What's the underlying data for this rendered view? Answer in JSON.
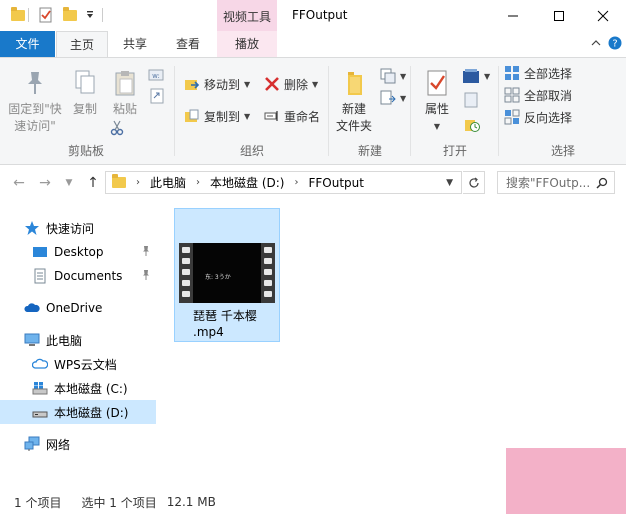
{
  "titlebar": {
    "contextual_tab_group": "视频工具",
    "window_title": "FFOutput",
    "buttons": [
      "minimize-icon",
      "maximize-icon",
      "close-icon"
    ]
  },
  "ribbon_tabs": {
    "file": "文件",
    "home": "主页",
    "share": "共享",
    "view": "查看",
    "play": "播放"
  },
  "ribbon": {
    "clipboard": {
      "title": "剪贴板",
      "pin_quick_access": "固定到\"快速访问\"",
      "pin_line1": "固定到\"快",
      "pin_line2": "速访问\"",
      "copy": "复制",
      "paste": "粘贴"
    },
    "organize": {
      "title": "组织",
      "move_to": "移动到",
      "copy_to": "复制到",
      "delete": "删除",
      "rename": "重命名"
    },
    "new": {
      "title": "新建",
      "new_folder_line1": "新建",
      "new_folder_line2": "文件夹"
    },
    "open": {
      "title": "打开",
      "properties": "属性"
    },
    "select": {
      "title": "选择",
      "select_all": "全部选择",
      "select_none": "全部取消",
      "invert": "反向选择"
    }
  },
  "address": {
    "crumbs": [
      "此电脑",
      "本地磁盘 (D:)",
      "FFOutput"
    ],
    "search_placeholder": "搜索\"FFOutp..."
  },
  "nav": {
    "quick_access": "快速访问",
    "desktop": "Desktop",
    "documents": "Documents",
    "onedrive": "OneDrive",
    "this_pc": "此电脑",
    "wps": "WPS云文档",
    "drive_c": "本地磁盘 (C:)",
    "drive_d": "本地磁盘 (D:)",
    "network": "网络"
  },
  "files": [
    {
      "name_line1": "琵琶 千本樱",
      "name_line2": ".mp4",
      "thumb_caption": "东: 3うか"
    }
  ],
  "status": {
    "count": "1 个项目",
    "selected": "选中 1 个项目",
    "size": "12.1 MB"
  },
  "colors": {
    "accent": "#1979ca",
    "selection": "#cce8ff",
    "context_tab": "#f7d7e7"
  }
}
